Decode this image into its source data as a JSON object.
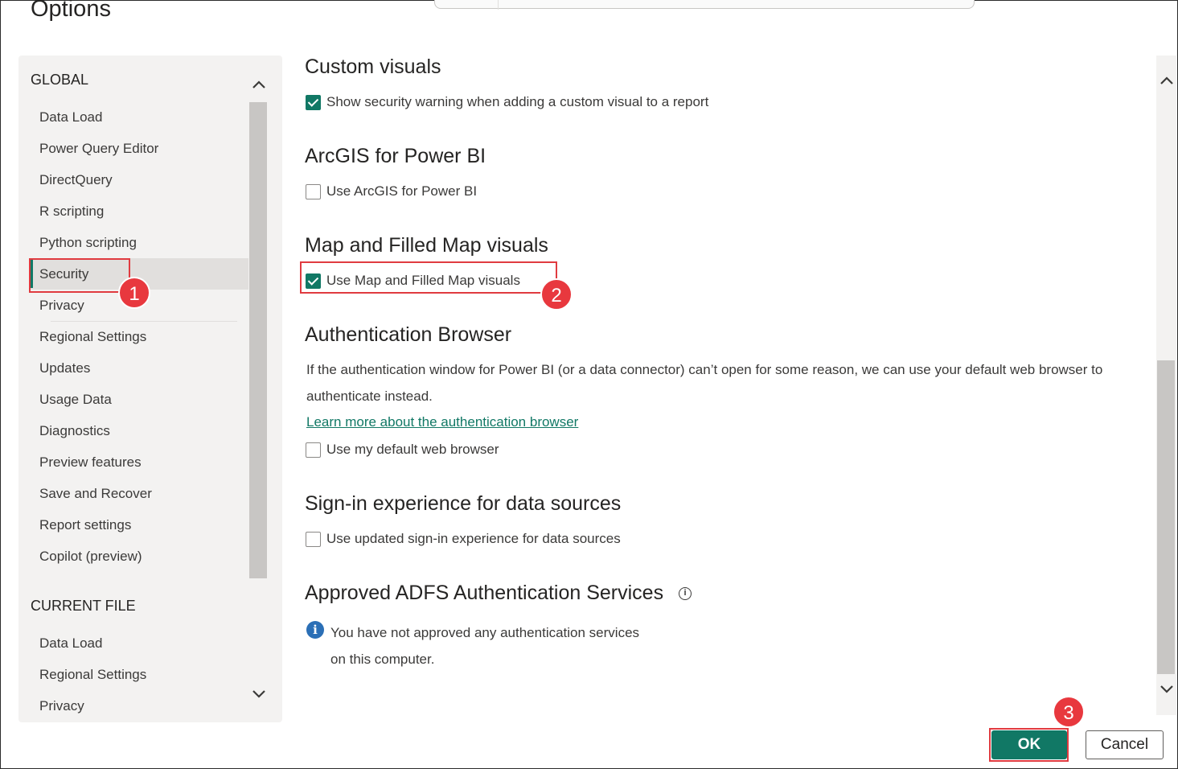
{
  "window": {
    "title": "Options"
  },
  "sidebar": {
    "global_heading": "GLOBAL",
    "global_items": [
      {
        "label": "Data Load"
      },
      {
        "label": "Power Query Editor"
      },
      {
        "label": "DirectQuery"
      },
      {
        "label": "R scripting"
      },
      {
        "label": "Python scripting"
      },
      {
        "label": "Security",
        "active": true
      },
      {
        "label": "Privacy"
      },
      {
        "label": "Regional Settings"
      },
      {
        "label": "Updates"
      },
      {
        "label": "Usage Data"
      },
      {
        "label": "Diagnostics"
      },
      {
        "label": "Preview features"
      },
      {
        "label": "Save and Recover"
      },
      {
        "label": "Report settings"
      },
      {
        "label": "Copilot (preview)"
      }
    ],
    "current_heading": "CURRENT FILE",
    "current_items": [
      {
        "label": "Data Load"
      },
      {
        "label": "Regional Settings"
      },
      {
        "label": "Privacy"
      }
    ],
    "scroll_up_icon": "chevron-up-icon",
    "scroll_down_icon": "chevron-down-icon"
  },
  "content": {
    "custom_visuals": {
      "heading": "Custom visuals",
      "checkbox_label": "Show security warning when adding a custom visual to a report",
      "checked": true
    },
    "arcgis": {
      "heading": "ArcGIS for Power BI",
      "checkbox_label": "Use ArcGIS for Power BI",
      "checked": false
    },
    "map_visuals": {
      "heading": "Map and Filled Map visuals",
      "checkbox_label": "Use Map and Filled Map visuals",
      "checked": true
    },
    "auth_browser": {
      "heading": "Authentication Browser",
      "description": "If the authentication window for Power BI (or a data connector) can’t open for some reason, we can use your default web browser to authenticate instead.",
      "link": "Learn more about the authentication browser",
      "checkbox_label": "Use my default web browser",
      "checked": false
    },
    "signin": {
      "heading": "Sign-in experience for data sources",
      "checkbox_label": "Use updated sign-in experience for data sources",
      "checked": false
    },
    "adfs": {
      "heading": "Approved ADFS Authentication Services",
      "info_icon": "info-circle-icon",
      "message_line1": "You have not approved any authentication services",
      "message_line2": "on this computer."
    }
  },
  "buttons": {
    "ok": "OK",
    "cancel": "Cancel"
  },
  "annotations": {
    "step1": "1",
    "step2": "2",
    "step3": "3",
    "color": "#e8383e"
  },
  "colors": {
    "accent": "#117865",
    "sidebar_bg": "#f3f2f1"
  }
}
